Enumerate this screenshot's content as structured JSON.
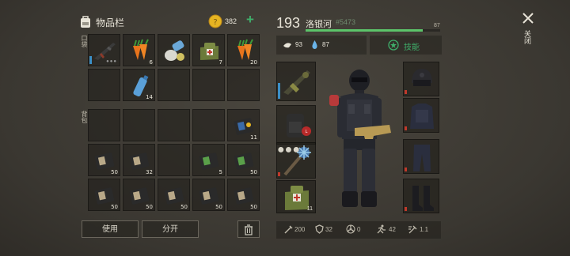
{
  "inventory": {
    "title": "物品栏",
    "coins": "382",
    "add_symbol": "+",
    "pocket_label": "口袋",
    "backpack_label": "背包",
    "use_label": "使用",
    "split_label": "分开"
  },
  "player": {
    "level": "193",
    "name": "洛银河",
    "id": "#5473",
    "health": "87",
    "food": "93",
    "water": "87",
    "skills_label": "技能"
  },
  "stats": {
    "attack": "200",
    "defense": "32",
    "radiation": "0",
    "speed": "42",
    "attack_speed": "1.1"
  },
  "close_label": "关闭",
  "slots": {
    "p0": "",
    "p1": "6",
    "p2": "",
    "p3": "7",
    "p4": "20",
    "p5": "",
    "p6": "14",
    "p7": "",
    "p8": "",
    "p9": "",
    "b4": "11",
    "b5": "50",
    "b6": "32",
    "b8": "5",
    "b9": "50",
    "b10": "50",
    "b11": "50",
    "b12": "50",
    "b13": "50",
    "b14": "50",
    "eq_grenade": "11"
  },
  "colors": {
    "accent_green": "#3fae6a",
    "health_bar": "#5cc46a",
    "gold": "#e6b422",
    "alert_red": "#c0392b"
  }
}
